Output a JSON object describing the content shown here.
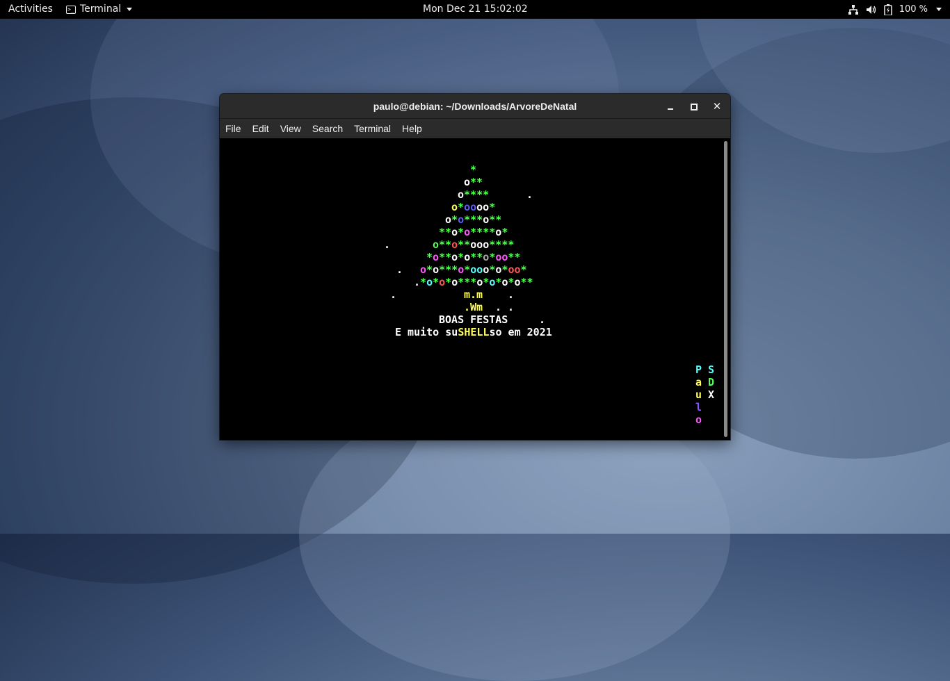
{
  "topbar": {
    "activities": "Activities",
    "app_name": "Terminal",
    "clock": "Mon Dec 21  15:02:02",
    "battery": "100 %"
  },
  "window": {
    "title": "paulo@debian: ~/Downloads/ArvoreDeNatal",
    "close_glyph": "✕",
    "menu": [
      "File",
      "Edit",
      "View",
      "Search",
      "Terminal",
      "Help"
    ]
  },
  "terminal": {
    "greeting": "BOAS FESTAS",
    "message_prefix": "E muito su",
    "message_highlight": "SHELL",
    "message_suffix": "so em 2021",
    "trunk_top": "m.m",
    "trunk_bottom": ".Wm",
    "signature_left": [
      "P",
      "a",
      "u",
      "l",
      "o"
    ],
    "signature_right": [
      "S",
      "D",
      "X"
    ]
  },
  "colors": {
    "terminal_bg": "#000000",
    "green": "#55ff55",
    "blue": "#5c5cff",
    "magenta": "#ff55ff",
    "red": "#ff5555",
    "yellow": "#ffff55",
    "cyan": "#55ffff",
    "titlebar": "#2b2b2b"
  },
  "icons": [
    "terminal-icon",
    "network-icon",
    "volume-icon",
    "battery-icon",
    "minimize-icon",
    "maximize-icon",
    "close-icon"
  ]
}
